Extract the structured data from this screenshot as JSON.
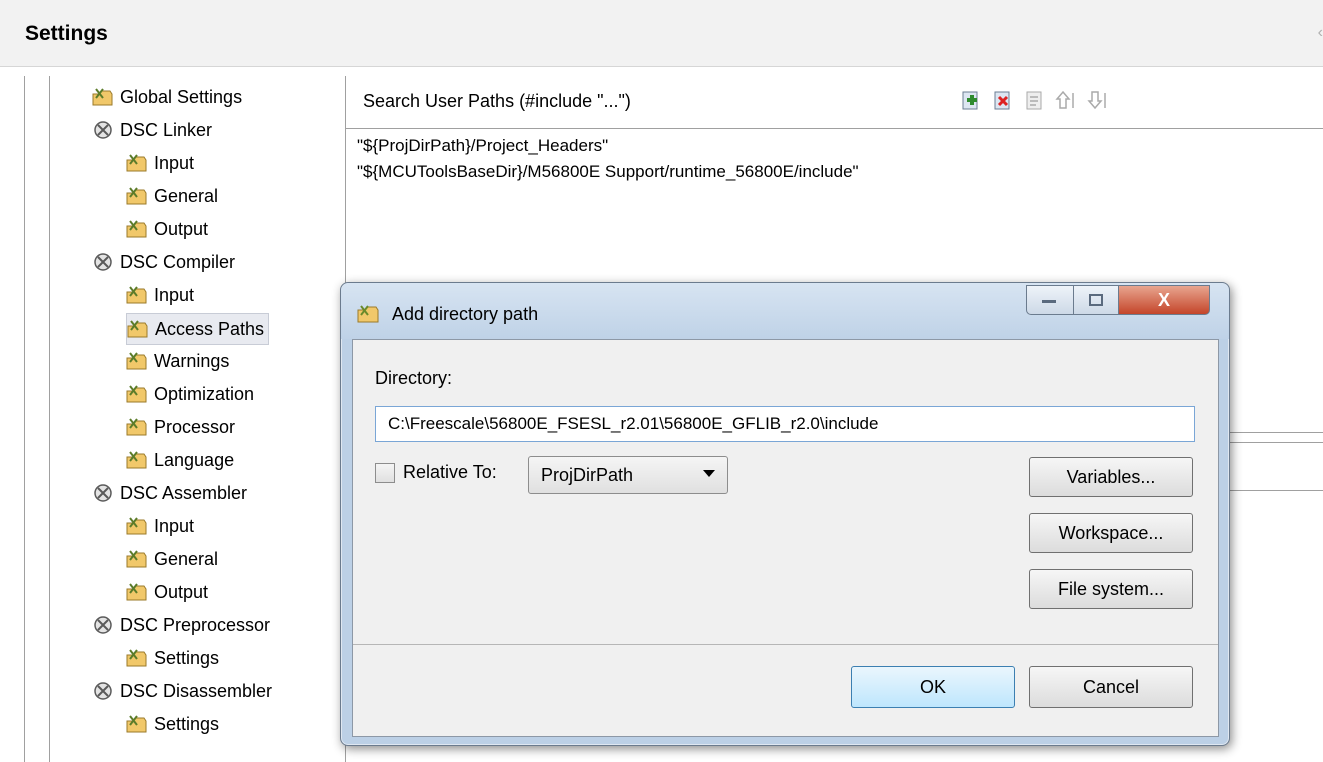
{
  "header": {
    "title": "Settings"
  },
  "tree": {
    "items": [
      {
        "label": "Global Settings",
        "level": 0,
        "kind": "leaf",
        "selected": false
      },
      {
        "label": "DSC Linker",
        "level": 0,
        "kind": "group",
        "selected": false
      },
      {
        "label": "Input",
        "level": 1,
        "kind": "leaf",
        "selected": false
      },
      {
        "label": "General",
        "level": 1,
        "kind": "leaf",
        "selected": false
      },
      {
        "label": "Output",
        "level": 1,
        "kind": "leaf",
        "selected": false
      },
      {
        "label": "DSC Compiler",
        "level": 0,
        "kind": "group",
        "selected": false
      },
      {
        "label": "Input",
        "level": 1,
        "kind": "leaf",
        "selected": false
      },
      {
        "label": "Access Paths",
        "level": 1,
        "kind": "leaf",
        "selected": true
      },
      {
        "label": "Warnings",
        "level": 1,
        "kind": "leaf",
        "selected": false
      },
      {
        "label": "Optimization",
        "level": 1,
        "kind": "leaf",
        "selected": false
      },
      {
        "label": "Processor",
        "level": 1,
        "kind": "leaf",
        "selected": false
      },
      {
        "label": "Language",
        "level": 1,
        "kind": "leaf",
        "selected": false
      },
      {
        "label": "DSC Assembler",
        "level": 0,
        "kind": "group",
        "selected": false
      },
      {
        "label": "Input",
        "level": 1,
        "kind": "leaf",
        "selected": false
      },
      {
        "label": "General",
        "level": 1,
        "kind": "leaf",
        "selected": false
      },
      {
        "label": "Output",
        "level": 1,
        "kind": "leaf",
        "selected": false
      },
      {
        "label": "DSC Preprocessor",
        "level": 0,
        "kind": "group",
        "selected": false
      },
      {
        "label": "Settings",
        "level": 1,
        "kind": "leaf",
        "selected": false
      },
      {
        "label": "DSC Disassembler",
        "level": 0,
        "kind": "group",
        "selected": false
      },
      {
        "label": "Settings",
        "level": 1,
        "kind": "leaf",
        "selected": false
      }
    ]
  },
  "panel": {
    "title": "Search User Paths (#include \"...\")",
    "toolbar": [
      "add-path-icon",
      "delete-path-icon",
      "edit-path-icon",
      "move-up-icon",
      "move-down-icon"
    ],
    "paths": [
      "\"${ProjDirPath}/Project_Headers\"",
      "\"${MCUToolsBaseDir}/M56800E Support/runtime_56800E/include\""
    ]
  },
  "dialog": {
    "title": "Add directory path",
    "directory_label": "Directory:",
    "directory_value": "C:\\Freescale\\56800E_FSESL_r2.01\\56800E_GFLIB_r2.0\\include",
    "relative_label": "Relative To:",
    "relative_checked": false,
    "relative_value": "ProjDirPath",
    "variables_button": "Variables...",
    "workspace_button": "Workspace...",
    "filesystem_button": "File system...",
    "ok_button": "OK",
    "cancel_button": "Cancel",
    "close_glyph": "X"
  },
  "colors": {
    "dialog_frame": "#bcd0e6",
    "close_button": "#c4452a",
    "ok_button": "#bee6fd",
    "selection": "#e8eaf0"
  }
}
